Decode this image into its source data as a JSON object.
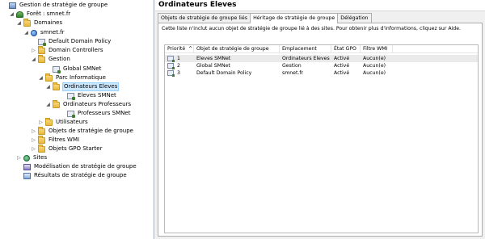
{
  "tree": [
    {
      "label": "Gestion de stratégie de groupe",
      "icon": "gpm-icon",
      "expander": ""
    },
    {
      "label": "Forêt : smnet.fr",
      "icon": "forest-icon",
      "expander": "◢"
    },
    {
      "label": "Domaines",
      "icon": "folder-icon",
      "expander": "◢"
    },
    {
      "label": "smnet.fr",
      "icon": "domain-icon",
      "expander": "◢"
    },
    {
      "label": "Default Domain Policy",
      "icon": "gpo-link-icon",
      "expander": ""
    },
    {
      "label": "Domain Controllers",
      "icon": "folder-icon",
      "expander": "▷"
    },
    {
      "label": "Gestion",
      "icon": "folder-icon",
      "expander": "◢"
    },
    {
      "label": "Global SMNet",
      "icon": "gpo-link-icon",
      "expander": ""
    },
    {
      "label": "Parc Informatique",
      "icon": "folder-icon",
      "expander": "◢"
    },
    {
      "label": "Ordinateurs Eleves",
      "icon": "folder-icon",
      "expander": "◢"
    },
    {
      "label": "Eleves SMNet",
      "icon": "gpo-link-icon",
      "expander": ""
    },
    {
      "label": "Ordinateurs Professeurs",
      "icon": "folder-icon",
      "expander": "◢"
    },
    {
      "label": "Professeurs SMNet",
      "icon": "gpo-link-icon",
      "expander": ""
    },
    {
      "label": "Utilisateurs",
      "icon": "folder-icon",
      "expander": "▷"
    },
    {
      "label": "Objets de stratégie de groupe",
      "icon": "folder-icon",
      "expander": "▷"
    },
    {
      "label": "Filtres WMI",
      "icon": "folder-icon",
      "expander": "▷"
    },
    {
      "label": "Objets GPO Starter",
      "icon": "folder-icon",
      "expander": "▷"
    },
    {
      "label": "Sites",
      "icon": "sites-icon",
      "expander": "▷"
    },
    {
      "label": "Modélisation de stratégie de groupe",
      "icon": "modeling-icon",
      "expander": ""
    },
    {
      "label": "Résultats de stratégie de groupe",
      "icon": "results-icon",
      "expander": ""
    }
  ],
  "selected_node": "Ordinateurs Eleves",
  "header": {
    "title": "Ordinateurs Eleves"
  },
  "tabs": [
    {
      "label": "Objets de stratégie de groupe liés",
      "active": false
    },
    {
      "label": "Héritage de stratégie de groupe",
      "active": true
    },
    {
      "label": "Délégation",
      "active": false
    }
  ],
  "description": "Cette liste n'inclut aucun objet de stratégie de groupe lié à des sites. Pour obtenir plus d'informations, cliquez sur Aide.",
  "table": {
    "columns": [
      "Priorité",
      "Objet de stratégie de groupe",
      "Emplacement",
      "État GPO",
      "Filtre WMI"
    ],
    "sort_indicator": "^",
    "rows": [
      {
        "priority": "1",
        "gpo": "Eleves SMNet",
        "location": "Ordinateurs Eleves",
        "status": "Activé",
        "wmi": "Aucun(e)"
      },
      {
        "priority": "2",
        "gpo": "Global SMNet",
        "location": "Gestion",
        "status": "Activé",
        "wmi": "Aucun(e)"
      },
      {
        "priority": "3",
        "gpo": "Default Domain Policy",
        "location": "smnet.fr",
        "status": "Activé",
        "wmi": "Aucun(e)"
      }
    ]
  },
  "colors": {
    "selection": "#cce8ff",
    "row_highlight": "#eaeaea",
    "border": "#adadad"
  }
}
